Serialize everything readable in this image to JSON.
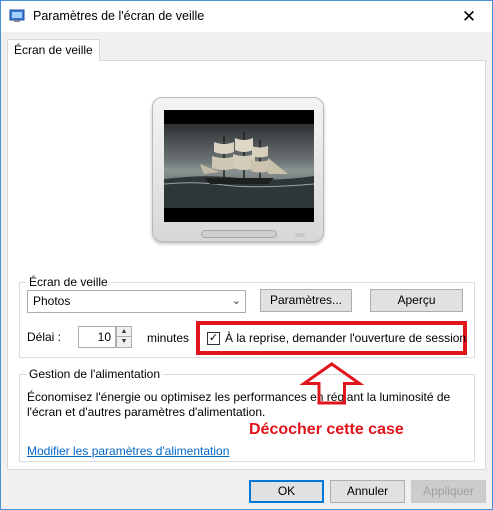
{
  "window": {
    "title": "Paramètres de l'écran de veille",
    "close_glyph": "✕"
  },
  "tab": {
    "label": "Écran de veille"
  },
  "screensaver": {
    "group_title": "Écran de veille",
    "selected": "Photos",
    "settings_button": "Paramètres...",
    "preview_button": "Aperçu",
    "delay_label": "Délai :",
    "delay_value": "10",
    "minutes_label": "minutes",
    "resume_checkbox_label": "À la reprise, demander l'ouverture de session",
    "resume_checked": true
  },
  "power": {
    "group_title": "Gestion de l'alimentation",
    "description": "Économisez l'énergie ou optimisez les performances en réglant la luminosité de l'écran et d'autres paramètres d'alimentation.",
    "link": "Modifier les paramètres d'alimentation"
  },
  "annotation": {
    "text": "Décocher cette case",
    "color": "#e2141b"
  },
  "footer": {
    "ok": "OK",
    "cancel": "Annuler",
    "apply": "Appliquer"
  },
  "colors": {
    "accent": "#0078d7",
    "link": "#0066cc",
    "highlight": "#e2141b"
  }
}
